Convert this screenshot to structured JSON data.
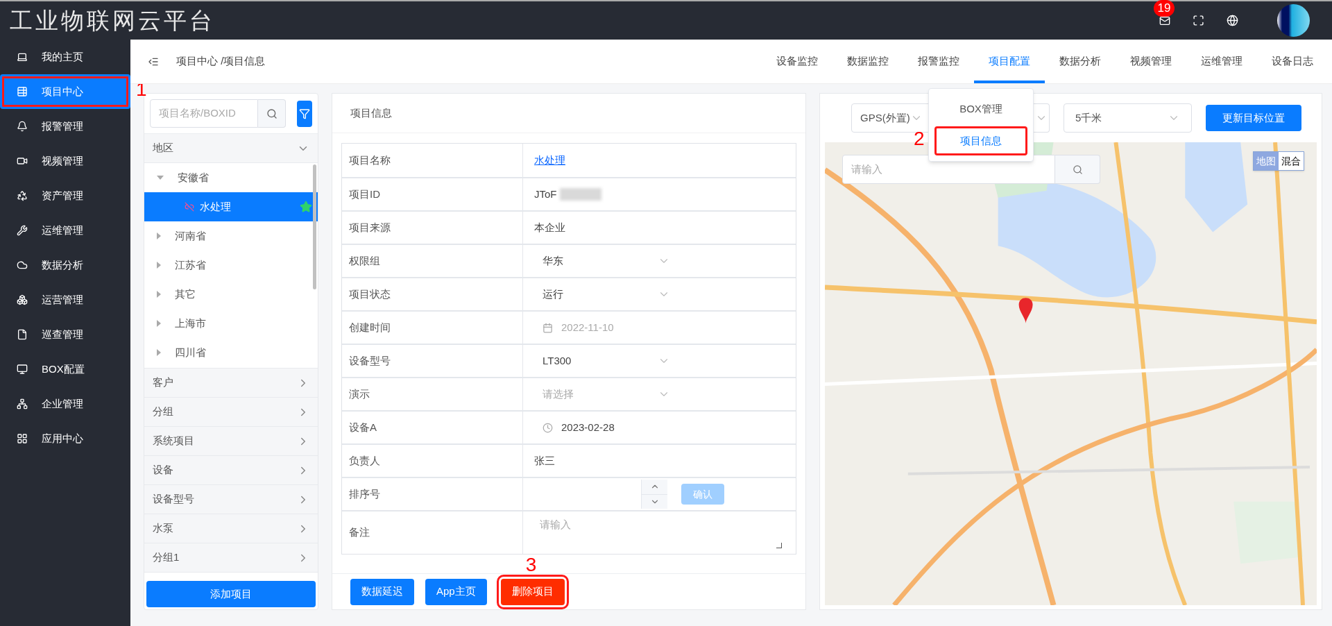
{
  "app_title": "工业物联网云平台",
  "top_bar": {
    "mail_badge": "19"
  },
  "sidebar": {
    "items": [
      {
        "label": "我的主页",
        "selected": false
      },
      {
        "label": "项目中心",
        "selected": true,
        "annotation": "1"
      },
      {
        "label": "报警管理",
        "selected": false
      },
      {
        "label": "视频管理",
        "selected": false
      },
      {
        "label": "资产管理",
        "selected": false
      },
      {
        "label": "运维管理",
        "selected": false
      },
      {
        "label": "数据分析",
        "selected": false
      },
      {
        "label": "运营管理",
        "selected": false
      },
      {
        "label": "巡查管理",
        "selected": false
      },
      {
        "label": "BOX配置",
        "selected": false
      },
      {
        "label": "企业管理",
        "selected": false
      },
      {
        "label": "应用中心",
        "selected": false
      }
    ]
  },
  "breadcrumb": "项目中心 /项目信息",
  "top_nav": {
    "items": [
      {
        "label": "设备监控",
        "selected": false
      },
      {
        "label": "数据监控",
        "selected": false
      },
      {
        "label": "报警监控",
        "selected": false
      },
      {
        "label": "项目配置",
        "selected": true
      },
      {
        "label": "数据分析",
        "selected": false
      },
      {
        "label": "视频管理",
        "selected": false
      },
      {
        "label": "运维管理",
        "selected": false
      },
      {
        "label": "设备日志",
        "selected": false
      }
    ]
  },
  "nav_dropdown": {
    "items": [
      {
        "label": "BOX管理",
        "selected": false
      },
      {
        "label": "项目信息",
        "selected": true,
        "annotation": "2"
      }
    ]
  },
  "project_tree": {
    "search_placeholder": "项目名称/BOXID",
    "sections": [
      {
        "label": "地区",
        "expanded": true,
        "children": [
          {
            "label": "安徽省",
            "expanded": true,
            "children": [
              {
                "label": "水处理",
                "selected": true,
                "starred": true
              }
            ]
          },
          {
            "label": "河南省",
            "expanded": false
          },
          {
            "label": "江苏省",
            "expanded": false
          },
          {
            "label": "其它",
            "expanded": false
          },
          {
            "label": "上海市",
            "expanded": false
          },
          {
            "label": "四川省",
            "expanded": false
          }
        ]
      },
      {
        "label": "客户",
        "expanded": false
      },
      {
        "label": "分组",
        "expanded": false
      },
      {
        "label": "系统项目",
        "expanded": false
      },
      {
        "label": "设备",
        "expanded": false
      },
      {
        "label": "设备型号",
        "expanded": false
      },
      {
        "label": "水泵",
        "expanded": false
      },
      {
        "label": "分组1",
        "expanded": false
      }
    ],
    "add_button": "添加项目"
  },
  "project_info": {
    "title": "项目信息",
    "rows": [
      {
        "label": "项目名称",
        "kind": "link",
        "value": "水处理"
      },
      {
        "label": "项目ID",
        "kind": "redacted",
        "value": "JToF"
      },
      {
        "label": "项目来源",
        "kind": "text",
        "value": "本企业"
      },
      {
        "label": "权限组",
        "kind": "select",
        "value": "华东"
      },
      {
        "label": "项目状态",
        "kind": "select",
        "value": "运行"
      },
      {
        "label": "创建时间",
        "kind": "date",
        "value": "2022-11-10",
        "disabled": true
      },
      {
        "label": "设备型号",
        "kind": "select",
        "value": "LT300"
      },
      {
        "label": "演示",
        "kind": "select",
        "placeholder": "请选择"
      },
      {
        "label": "设备A",
        "kind": "time",
        "value": "2023-02-28",
        "disabled": false
      },
      {
        "label": "负责人",
        "kind": "text",
        "value": "张三"
      },
      {
        "label": "排序号",
        "kind": "number",
        "button": "确认"
      },
      {
        "label": "备注",
        "kind": "textarea",
        "placeholder": "请输入"
      }
    ],
    "buttons": [
      {
        "label": "数据延迟",
        "kind": "primary"
      },
      {
        "label": "App主页",
        "kind": "primary"
      },
      {
        "label": "删除项目",
        "kind": "danger",
        "annotation": "3"
      }
    ]
  },
  "map_panel": {
    "source_select": "GPS(外置)",
    "distance_select": "5千米",
    "update_button": "更新目标位置",
    "search_placeholder": "请输入",
    "map_types": [
      {
        "label": "地图",
        "selected": true
      },
      {
        "label": "混合",
        "selected": false
      }
    ]
  }
}
